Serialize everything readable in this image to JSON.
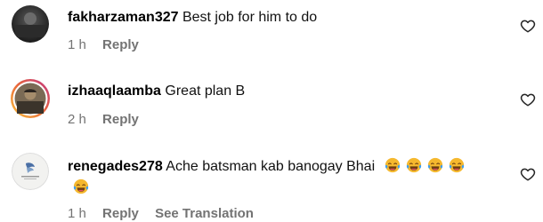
{
  "comments": [
    {
      "username": "fakharzaman327",
      "text": "Best job for him to do",
      "time": "1 h",
      "reply_label": "Reply",
      "avatar_icon": "profile-photo-dark",
      "like_icon": "heart-outline-icon"
    },
    {
      "username": "izhaaqlaamba",
      "text": "Great plan B",
      "time": "2 h",
      "reply_label": "Reply",
      "avatar_icon": "profile-photo-story-ring",
      "like_icon": "heart-outline-icon"
    },
    {
      "username": "renegades278",
      "text": "Ache batsman kab banogay Bhai",
      "emojis": [
        "face-with-tears-of-joy",
        "face-with-tears-of-joy",
        "face-with-tears-of-joy",
        "face-with-tears-of-joy",
        "face-with-tears-of-joy"
      ],
      "time": "1 h",
      "reply_label": "Reply",
      "translation_label": "See Translation",
      "avatar_icon": "profile-logo-light",
      "like_icon": "heart-outline-icon"
    }
  ],
  "colors": {
    "meta_text": "#737373",
    "username": "#000000",
    "emoji_face": "#f5b82e",
    "emoji_tears": "#3b9df0"
  }
}
